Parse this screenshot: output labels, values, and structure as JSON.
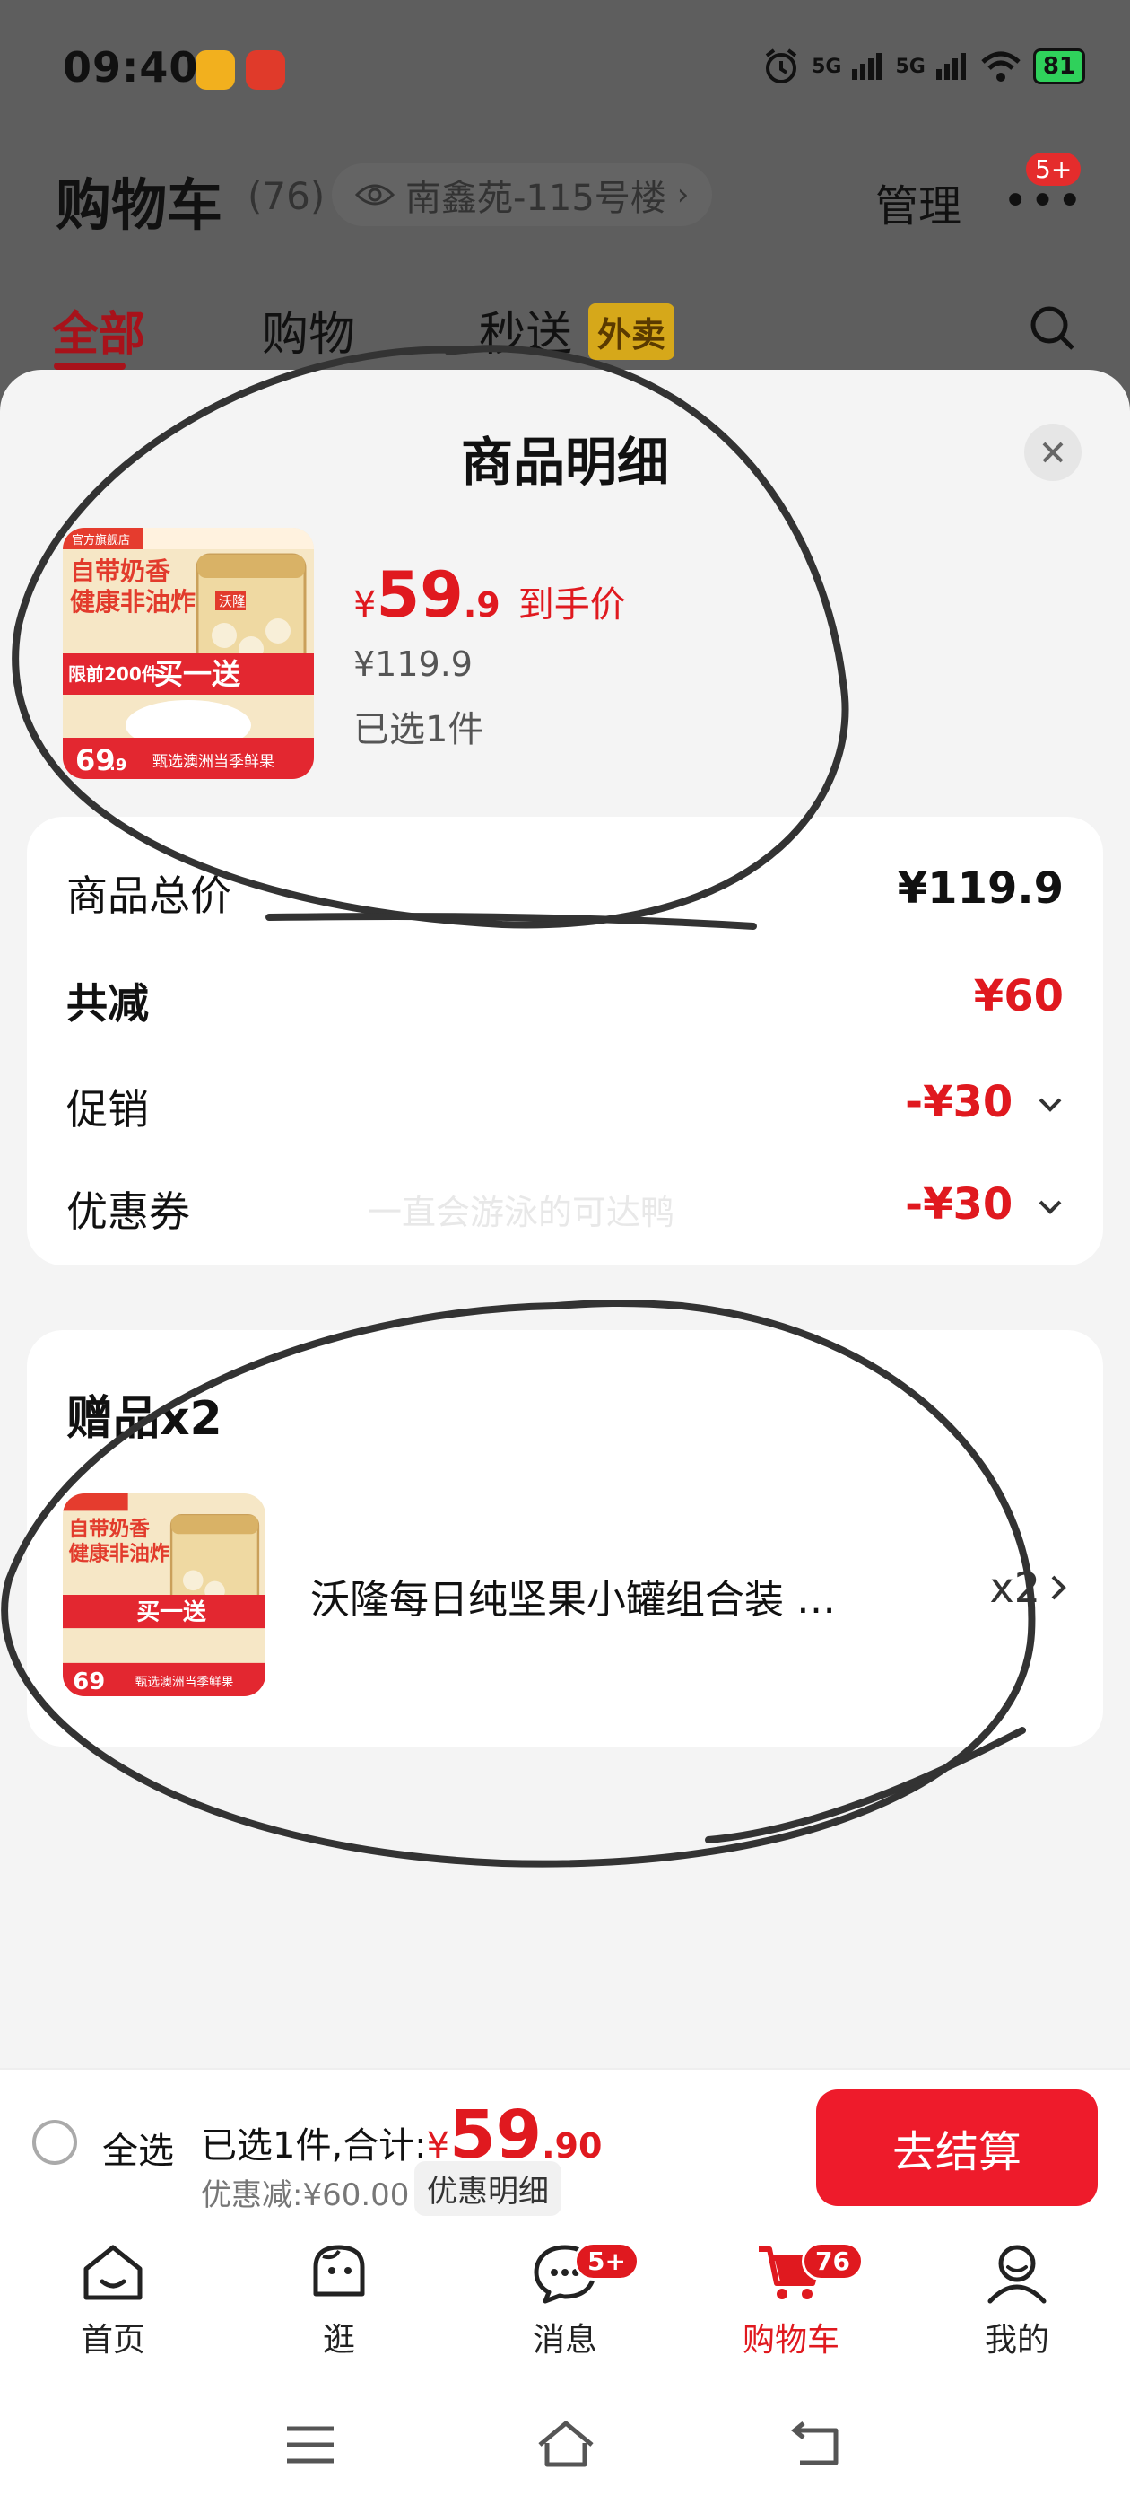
{
  "status_bar": {
    "time": "09:40",
    "signal1": "5G",
    "signal2": "5G",
    "battery": "81"
  },
  "header": {
    "title": "购物车",
    "count": "(76)",
    "address": "南鑫苑-115号楼",
    "manage": "管理",
    "more_badge": "5+"
  },
  "tabs": [
    {
      "label": "全部"
    },
    {
      "label": "购物"
    },
    {
      "label": "秒送",
      "tag": "外卖"
    }
  ],
  "sheet": {
    "title": "商品明细",
    "product": {
      "price_currency": "¥",
      "price_int": "59",
      "price_dec": ".9",
      "price_label": "到手价",
      "original_price": "¥119.9",
      "selected": "已选1件",
      "image": {
        "badge": "官方旗舰店",
        "line1": "自带奶香",
        "line2": "健康非油炸",
        "brand": "沃隆",
        "promo": "限前200件",
        "promo_big": "买一送",
        "price_tag": "69",
        "price_tag_dec": ".9",
        "footer": "甄选澳洲当季鲜果"
      }
    },
    "summary": {
      "rows": [
        {
          "label": "商品总价",
          "value": "¥119.9"
        },
        {
          "label": "共减",
          "value": "¥60"
        },
        {
          "label": "促销",
          "value": "-¥30"
        },
        {
          "label": "优惠券",
          "value": "-¥30"
        }
      ],
      "watermark": "一直会游泳的可达鸭"
    },
    "gift": {
      "title": "赠品x2",
      "name": "沃隆每日纯坚果小罐组合装 …",
      "qty": "x2"
    }
  },
  "checkout": {
    "select_all": "全选",
    "selected_prefix": "已选1件,合计:",
    "total_currency": "¥",
    "total_int": "59",
    "total_dec": ".90",
    "discount": "优惠减:¥60.00",
    "discount_detail": "优惠明细",
    "button": "去结算"
  },
  "bottom_nav": [
    {
      "label": "首页",
      "icon": "home-icon"
    },
    {
      "label": "逛",
      "icon": "browse-icon"
    },
    {
      "label": "消息",
      "icon": "message-icon",
      "badge": "5+"
    },
    {
      "label": "购物车",
      "icon": "cart-icon",
      "badge": "76",
      "active": true
    },
    {
      "label": "我的",
      "icon": "profile-icon"
    }
  ],
  "colors": {
    "accent": "#e0191f",
    "checkout_button": "#ee1b2b",
    "tab_active": "#a8121a"
  }
}
